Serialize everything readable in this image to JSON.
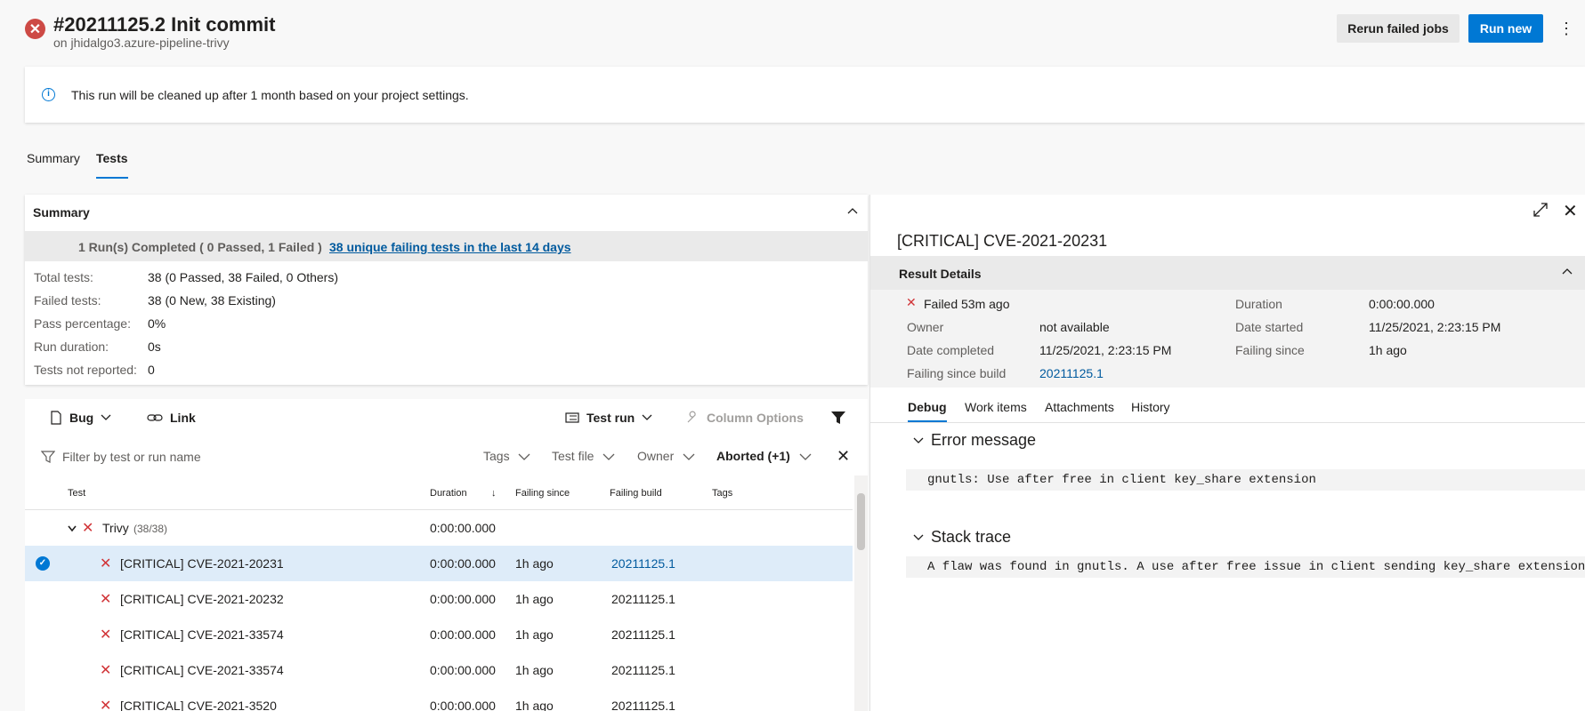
{
  "header": {
    "title": "#20211125.2 Init commit",
    "subtitle": "on jhidalgo3.azure-pipeline-trivy",
    "rerun_label": "Rerun failed jobs",
    "run_new_label": "Run new",
    "more_glyph": "⋮"
  },
  "banner": {
    "text": "This run will be cleaned up after 1 month based on your project settings."
  },
  "tabs": [
    {
      "label": "Summary"
    },
    {
      "label": "Tests"
    }
  ],
  "summary": {
    "heading": "Summary",
    "band_text": "1 Run(s) Completed ( 0 Passed, 1 Failed )",
    "band_link": "38 unique failing tests in the last 14 days",
    "stats": [
      {
        "label": "Total tests:",
        "value": "38 (0 Passed, 38 Failed, 0 Others)"
      },
      {
        "label": "Failed tests:",
        "value": "38 (0 New, 38 Existing)"
      },
      {
        "label": "Pass percentage:",
        "value": "0%"
      },
      {
        "label": "Run duration:",
        "value": "0s"
      },
      {
        "label": "Tests not reported:",
        "value": "0"
      }
    ]
  },
  "toolbar": {
    "bug": "Bug",
    "link": "Link",
    "test_run": "Test run",
    "column_options": "Column Options"
  },
  "filters": {
    "placeholder": "Filter by test or run name",
    "tags": "Tags",
    "test_file": "Test file",
    "owner": "Owner",
    "outcome": "Aborted (+1)"
  },
  "columns": {
    "test": "Test",
    "duration": "Duration",
    "failing_since": "Failing since",
    "failing_build": "Failing build",
    "tags": "Tags"
  },
  "group": {
    "name": "Trivy",
    "count": "(38/38)",
    "duration": "0:00:00.000"
  },
  "rows": [
    {
      "name": "[CRITICAL] CVE-2021-20231",
      "duration": "0:00:00.000",
      "since": "1h ago",
      "build": "20211125.1"
    },
    {
      "name": "[CRITICAL] CVE-2021-20232",
      "duration": "0:00:00.000",
      "since": "1h ago",
      "build": "20211125.1"
    },
    {
      "name": "[CRITICAL] CVE-2021-33574",
      "duration": "0:00:00.000",
      "since": "1h ago",
      "build": "20211125.1"
    },
    {
      "name": "[CRITICAL] CVE-2021-33574",
      "duration": "0:00:00.000",
      "since": "1h ago",
      "build": "20211125.1"
    },
    {
      "name": "[CRITICAL] CVE-2021-3520",
      "duration": "0:00:00.000",
      "since": "1h ago",
      "build": "20211125.1"
    }
  ],
  "detail": {
    "title": "[CRITICAL] CVE-2021-20231",
    "result_heading": "Result Details",
    "failed_text": "Failed 53m ago",
    "owner_label": "Owner",
    "owner_value": "not available",
    "completed_label": "Date completed",
    "completed_value": "11/25/2021, 2:23:15 PM",
    "since_build_label": "Failing since build",
    "since_build_value": "20211125.1",
    "duration_label": "Duration",
    "duration_value": "0:00:00.000",
    "started_label": "Date started",
    "started_value": "11/25/2021, 2:23:15 PM",
    "failing_since_label": "Failing since",
    "failing_since_value": "1h ago",
    "tabs": [
      "Debug",
      "Work items",
      "Attachments",
      "History"
    ],
    "error_heading": "Error message",
    "error_text": "gnutls: Use after free in client key_share extension",
    "stack_heading": "Stack trace",
    "stack_text": "A flaw was found in gnutls. A use after free issue in client sending key_share extension"
  }
}
